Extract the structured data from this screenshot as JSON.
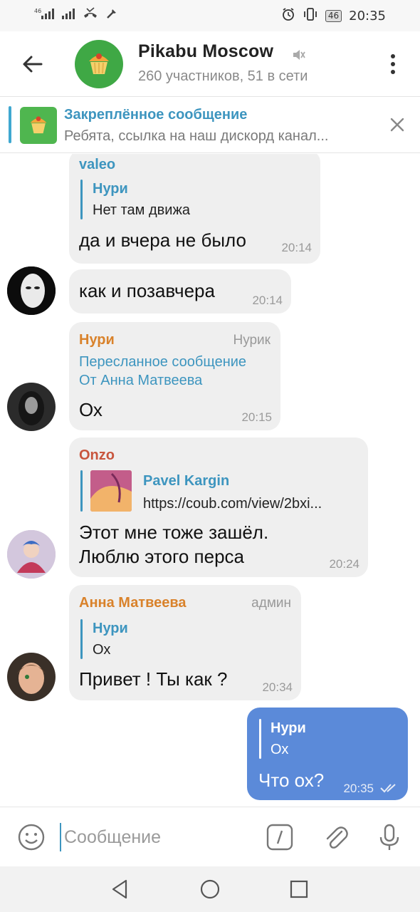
{
  "status_bar": {
    "left_signal_1": "46",
    "right_battery": "46",
    "time": "20:35"
  },
  "header": {
    "title": "Pikabu Moscow",
    "subtitle": "260 участников, 51 в сети"
  },
  "pinned": {
    "title": "Закреплённое сообщение",
    "text": "Ребята, ссылка на наш дискорд канал..."
  },
  "messages": [
    {
      "author": "valeo",
      "quote_author": "Нури",
      "quote_text": "Нет там движа",
      "text": "да и вчера не было",
      "time": "20:14"
    },
    {
      "text": "как и позавчера",
      "time": "20:14"
    },
    {
      "author": "Нури",
      "role": "Нурик",
      "forwarded_label": "Пересланное сообщение",
      "forwarded_from": "От Анна Матвеева",
      "text": "Ох",
      "time": "20:15"
    },
    {
      "author": "Onzo",
      "quote_author": "Pavel Kargin",
      "quote_text": "https://coub.com/view/2bxi...",
      "text_line1": "Этот мне тоже зашёл.",
      "text_line2": "Люблю этого перса",
      "time": "20:24"
    },
    {
      "author": "Анна Матвеева",
      "role": "админ",
      "quote_author": "Нури",
      "quote_text": "Ох",
      "text": "Привет ! Ты как ?",
      "time": "20:34"
    },
    {
      "quote_author": "Нури",
      "quote_text": "Ох",
      "text": "Что ох?",
      "time": "20:35"
    }
  ],
  "input": {
    "placeholder": "Сообщение"
  },
  "colors": {
    "link_blue": "#3d95bf",
    "author_orange": "#d9822b",
    "author_red": "#c8553d",
    "out_bubble": "#5b8ad9",
    "group_avatar": "#3fa845"
  },
  "icons": [
    "back-arrow-icon",
    "cupcake-icon",
    "mute-icon",
    "more-vert-icon",
    "close-icon",
    "emoji-icon",
    "command-icon",
    "attach-icon",
    "mic-icon",
    "nav-back-icon",
    "nav-home-icon",
    "nav-recents-icon",
    "double-check-icon"
  ]
}
